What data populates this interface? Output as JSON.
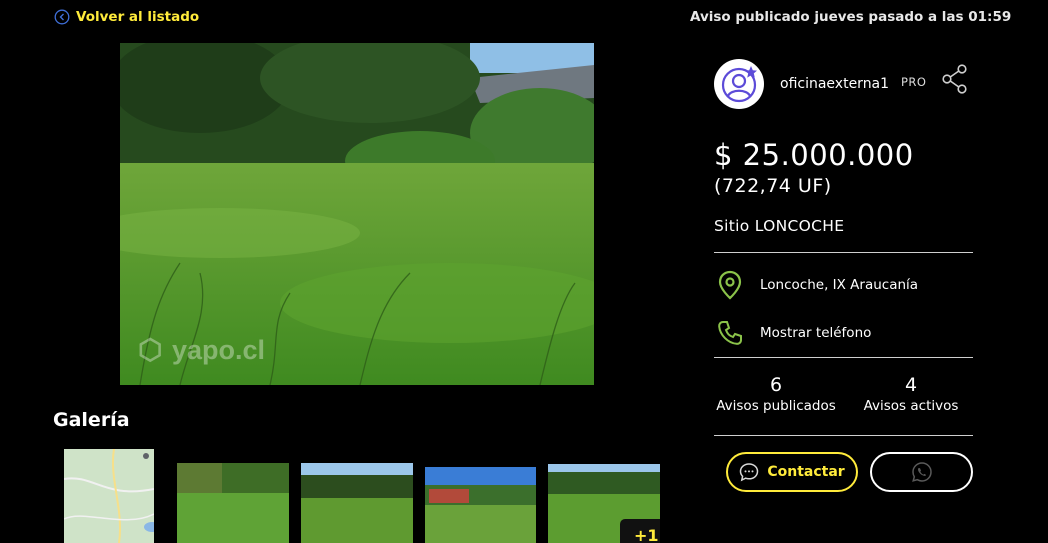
{
  "nav": {
    "back_label": "Volver al listado"
  },
  "listing": {
    "posted": "Aviso publicado jueves pasado a las 01:59",
    "price": "$ 25.000.000",
    "price_uf": "(722,74 UF)",
    "title": "Sitio LONCOCHE",
    "location": "Loncoche, IX Araucanía",
    "phone_label": "Mostrar teléfono"
  },
  "seller": {
    "name": "oficinaexterna1",
    "badge": "PRO",
    "stats": [
      {
        "value": "6",
        "label": "Avisos publicados"
      },
      {
        "value": "4",
        "label": "Avisos activos"
      }
    ]
  },
  "gallery": {
    "title": "Galería",
    "more_label": "+1",
    "watermark": "yapo.cl"
  },
  "actions": {
    "contact_label": "Contactar"
  },
  "colors": {
    "accent": "#ffeb3b",
    "location_icon": "#8bc34a",
    "avatar_icon": "#5c4bd8"
  }
}
